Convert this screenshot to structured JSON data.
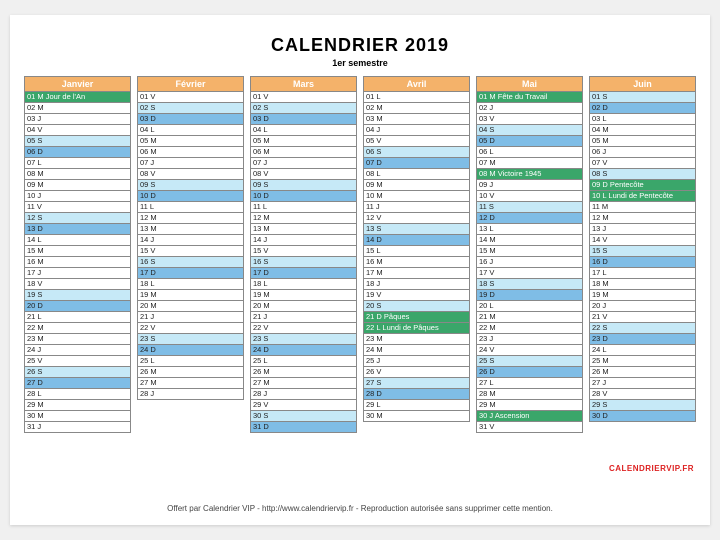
{
  "title": "CALENDRIER 2019",
  "subtitle": "1er semestre",
  "brand": "CALENDRIERVIP.FR",
  "footer": "Offert par Calendrier VIP - http://www.calendriervip.fr - Reproduction autorisée sans supprimer cette mention.",
  "dow": [
    "L",
    "M",
    "M",
    "J",
    "V",
    "S",
    "D"
  ],
  "months": [
    {
      "name": "Janvier",
      "days": 31,
      "start": 1,
      "holidays": {
        "1": "Jour de l'An"
      }
    },
    {
      "name": "Février",
      "days": 28,
      "start": 4,
      "holidays": {}
    },
    {
      "name": "Mars",
      "days": 31,
      "start": 4,
      "holidays": {}
    },
    {
      "name": "Avril",
      "days": 30,
      "start": 0,
      "holidays": {
        "21": "Pâques",
        "22": "Lundi de Pâques"
      }
    },
    {
      "name": "Mai",
      "days": 31,
      "start": 2,
      "holidays": {
        "1": "Fête du Travail",
        "8": "Victoire 1945",
        "30": "Ascension"
      }
    },
    {
      "name": "Juin",
      "days": 30,
      "start": 5,
      "holidays": {
        "9": "Pentecôte",
        "10": "Lundi de Pentecôte"
      }
    }
  ]
}
